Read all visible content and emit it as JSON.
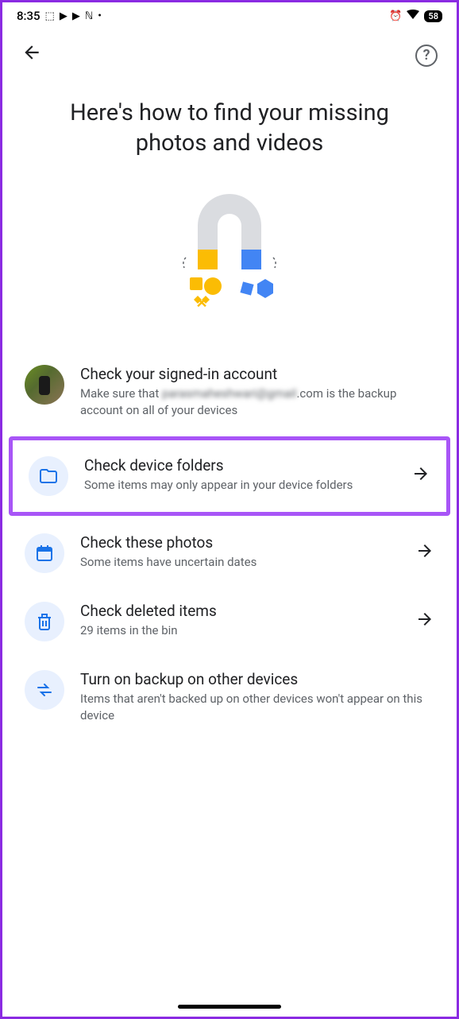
{
  "status": {
    "time": "8:35",
    "battery": "58"
  },
  "page": {
    "title": "Here's how to find your missing photos and videos"
  },
  "items": {
    "account": {
      "title": "Check your signed-in account",
      "subtitle_prefix": "Make sure that ",
      "subtitle_blurred": "parasmaheshwari@gmail",
      "subtitle_suffix": ".com is the backup account on all of your devices"
    },
    "folders": {
      "title": "Check device folders",
      "subtitle": "Some items may only appear in your device folders"
    },
    "photos": {
      "title": "Check these photos",
      "subtitle": "Some items have uncertain dates"
    },
    "deleted": {
      "title": "Check deleted items",
      "subtitle": "29 items in the bin"
    },
    "backup": {
      "title": "Turn on backup on other devices",
      "subtitle": "Items that aren't backed up on other devices won't appear on this device"
    }
  }
}
